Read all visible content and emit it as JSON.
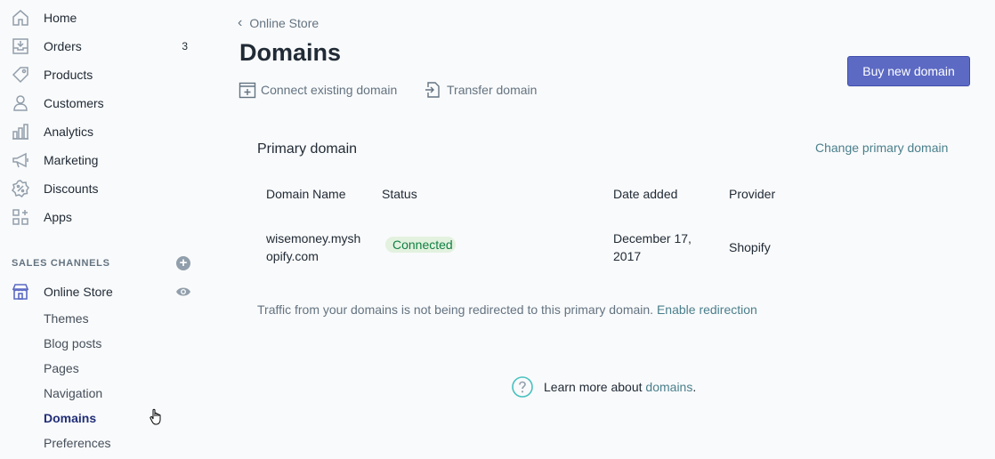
{
  "sidebar": {
    "items": [
      {
        "label": "Home",
        "icon": "home-icon"
      },
      {
        "label": "Orders",
        "icon": "orders-icon",
        "badge": "3"
      },
      {
        "label": "Products",
        "icon": "tag-icon"
      },
      {
        "label": "Customers",
        "icon": "person-icon"
      },
      {
        "label": "Analytics",
        "icon": "bar-chart-icon"
      },
      {
        "label": "Marketing",
        "icon": "megaphone-icon"
      },
      {
        "label": "Discounts",
        "icon": "discount-icon"
      },
      {
        "label": "Apps",
        "icon": "apps-icon"
      }
    ],
    "section_label": "SALES CHANNELS",
    "channel": {
      "label": "Online Store",
      "icon": "store-icon"
    },
    "sub_items": [
      "Themes",
      "Blog posts",
      "Pages",
      "Navigation",
      "Domains",
      "Preferences"
    ],
    "active_sub": "Domains"
  },
  "header": {
    "breadcrumb": "Online Store",
    "title": "Domains",
    "actions": {
      "connect": "Connect existing domain",
      "transfer": "Transfer domain"
    },
    "buy_button": "Buy new domain"
  },
  "primary": {
    "title": "Primary domain",
    "change_link": "Change primary domain",
    "columns": [
      "Domain Name",
      "Status",
      "Date added",
      "Provider"
    ],
    "row": {
      "domain_line1": "wisemoney.mysh",
      "domain_line2": "opify.com",
      "status": "Connected",
      "date_line1": "December 17,",
      "date_line2": "2017",
      "provider": "Shopify"
    },
    "traffic_text": "Traffic from your domains is not being redirected to this primary domain.",
    "traffic_link": "Enable redirection"
  },
  "footer": {
    "learn_text": "Learn more about",
    "learn_link": "domains",
    "learn_suffix": "."
  },
  "colors": {
    "accent": "#5c6ac4",
    "link": "#4a7f8c",
    "status_bg": "#e3f1df",
    "status_text": "#108043"
  }
}
